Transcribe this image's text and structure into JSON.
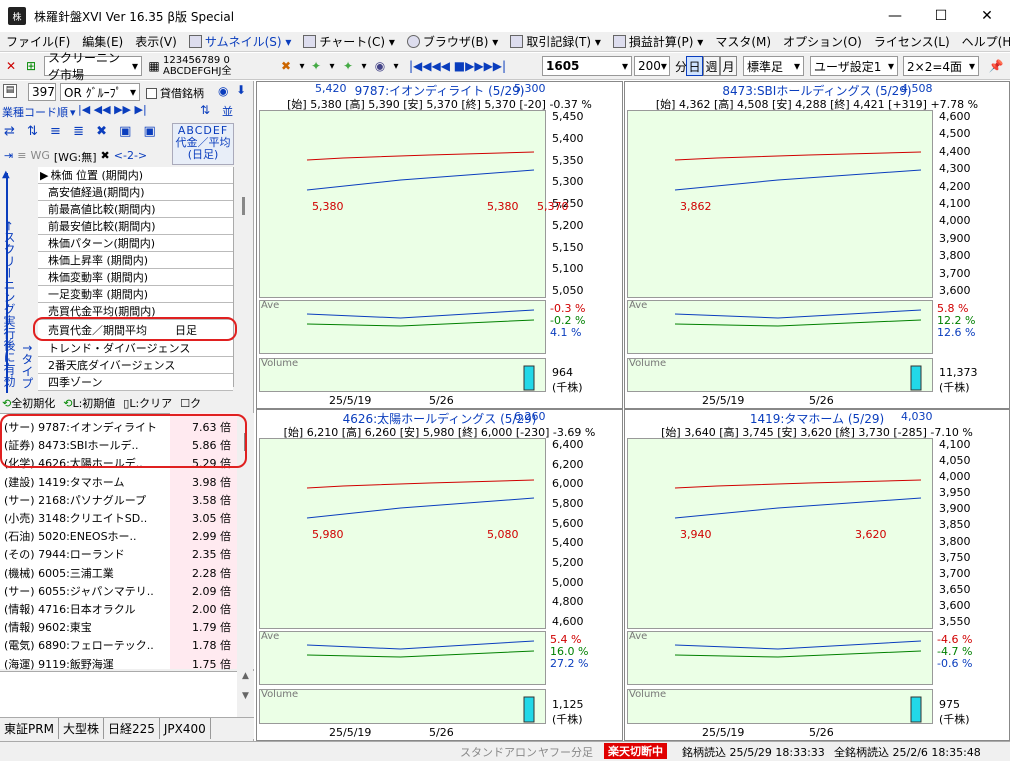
{
  "window": {
    "title": "株羅針盤XVI Ver 16.35 β版  Special",
    "app_icon": "株"
  },
  "menu": [
    "ファイル(F)",
    "編集(E)",
    "表示(V)",
    "サムネイル(S)",
    "チャート(C)",
    "ブラウザ(B)",
    "取引記録(T)",
    "損益計算(P)",
    "マスタ(M)",
    "オプション(O)",
    "ライセンス(L)",
    "ヘルプ(H)"
  ],
  "toolbar": {
    "market": "スクリーニング市場",
    "groups1": "123456789 0",
    "groups2": "ABCDEFGHJ全",
    "nav": "|◀◀◀◀ ■▶▶▶▶|",
    "code": "1605",
    "bars": "200",
    "period_unit": "分",
    "day_btn": "日",
    "week_btn": "週",
    "month_btn": "月",
    "standard_foot": "標準足",
    "user_setting": "ユーザ設定1",
    "layout": "2×2=4面",
    "pin": "ᚑ"
  },
  "left": {
    "count": "397",
    "group_sel": "OR ｸﾞﾙｰﾌﾟ",
    "credit_label": "貸借銘柄",
    "sort_label": "業種コード順",
    "abc": "ABCDEF",
    "wg": "WG",
    "wg_value": "[WG:無]",
    "range": "<-2->",
    "col_header": "代金／平均\n(日足)",
    "screen_label": "←スクリーニング実行後に有効",
    "type_label": "↑タイプ",
    "criteria": [
      "株価 位置 (期間内)",
      "高安値経過(期間内)",
      "前最高値比較(期間内)",
      "前最安値比較(期間内)",
      "株価パターン(期間内)",
      "株価上昇率 (期間内)",
      "株価変動率 (期間内)",
      "一足変動率 (期間内)",
      "売買代金平均(期間内)",
      "売買代金／期間平均",
      "トレンド・ダイバージェンス",
      "2番天底ダイバージェンス",
      "四季ゾーン"
    ],
    "selected_criterion": "売買代金／期間平均",
    "selected_foot": "日足",
    "btn_init_all": "全初期化",
    "btn_init_l": "L:初期値",
    "btn_clear_l": "L:クリア",
    "btn_k": "ク",
    "stocks": [
      {
        "name": "(サー) 9787:イオンディライト",
        "val": "7.63 倍"
      },
      {
        "name": "(証券) 8473:SBIホールデ..",
        "val": "5.86 倍"
      },
      {
        "name": "(化学) 4626:太陽ホールデ..",
        "val": "5.29 倍"
      },
      {
        "name": "(建設) 1419:タマホーム",
        "val": "3.98 倍"
      },
      {
        "name": "(サー) 2168:パソナグループ",
        "val": "3.58 倍"
      },
      {
        "name": "(小売) 3148:クリエイトSD..",
        "val": "3.05 倍"
      },
      {
        "name": "(石油) 5020:ENEOSホー..",
        "val": "2.99 倍"
      },
      {
        "name": "(その) 7944:ローランド",
        "val": "2.35 倍"
      },
      {
        "name": "(機械) 6005:三浦工業",
        "val": "2.28 倍"
      },
      {
        "name": "(サー) 6055:ジャパンマテリ..",
        "val": "2.09 倍"
      },
      {
        "name": "(情報) 4716:日本オラクル",
        "val": "2.00 倍"
      },
      {
        "name": "(情報) 9602:東宝",
        "val": "1.79 倍"
      },
      {
        "name": "(電気) 6890:フェローテック..",
        "val": "1.78 倍"
      },
      {
        "name": "(海運) 9119:飯野海運",
        "val": "1.75 倍"
      }
    ],
    "market_tabs": [
      "東証PRM",
      "大型株",
      "日経225",
      "JPX400"
    ]
  },
  "charts": [
    {
      "title": "9787:イオンディライト (5/29)",
      "info": "[始] 5,380 [高] 5,390 [安] 5,370 [終] 5,370 [-20] -0.37 %",
      "corner_left": "5,420",
      "corner_right": "5,300",
      "y_ticks": [
        "5,450",
        "5,400",
        "5,350",
        "5,300",
        "5,250",
        "5,200",
        "5,150",
        "5,100",
        "5,050"
      ],
      "labels": [
        {
          "t": "5,380",
          "c": "#d00000"
        },
        {
          "t": "5,380",
          "c": "#d00000"
        },
        {
          "t": "5,370",
          "c": "#d00000"
        }
      ],
      "ave_ticks": [
        "-0.3 %",
        "-0.2 %",
        "4.1 %"
      ],
      "ave_label": "Ave",
      "vol_label": "Volume",
      "vol_max": "964",
      "vol_unit": "(千株)",
      "dates": [
        "25/5/19",
        "5/26"
      ]
    },
    {
      "title": "8473:SBIホールディングス (5/29)",
      "info": "[始] 4,362 [高] 4,508 [安] 4,288 [終] 4,421 [+319] +7.78 %",
      "corner_left": "",
      "corner_right": "4,508",
      "y_ticks": [
        "4,600",
        "4,500",
        "4,400",
        "4,300",
        "4,200",
        "4,100",
        "4,000",
        "3,900",
        "3,800",
        "3,700",
        "3,600"
      ],
      "labels": [
        {
          "t": "3,862",
          "c": "#d00000"
        }
      ],
      "ave_ticks": [
        "5.8 %",
        "12.2 %",
        "12.6 %"
      ],
      "ave_label": "Ave",
      "vol_label": "Volume",
      "vol_max": "11,373",
      "vol_unit": "(千株)",
      "dates": [
        "25/5/19",
        "5/26"
      ]
    },
    {
      "title": "4626:太陽ホールディングス (5/29)",
      "info": "[始] 6,210 [高] 6,260 [安] 5,980 [終] 6,000 [-230] -3.69 %",
      "corner_left": "",
      "corner_right": "6,260",
      "y_ticks": [
        "6,400",
        "6,200",
        "6,000",
        "5,800",
        "5,600",
        "5,400",
        "5,200",
        "5,000",
        "4,800",
        "4,600"
      ],
      "labels": [
        {
          "t": "5,980",
          "c": "#d00000"
        },
        {
          "t": "5,080",
          "c": "#d00000"
        }
      ],
      "ave_ticks": [
        "5.4 %",
        "16.0 %",
        "27.2 %"
      ],
      "ave_label": "Ave",
      "vol_label": "Volume",
      "vol_max": "1,125",
      "vol_unit": "(千株)",
      "dates": [
        "25/5/19",
        "5/26"
      ]
    },
    {
      "title": "1419:タマホーム (5/29)",
      "info": "[始] 3,640 [高] 3,745 [安] 3,620 [終] 3,730 [-285] -7.10 %",
      "corner_left": "",
      "corner_right": "4,030",
      "y_ticks": [
        "4,100",
        "4,050",
        "4,000",
        "3,950",
        "3,900",
        "3,850",
        "3,800",
        "3,750",
        "3,700",
        "3,650",
        "3,600",
        "3,550"
      ],
      "labels": [
        {
          "t": "3,940",
          "c": "#d00000"
        },
        {
          "t": "3,620",
          "c": "#d00000"
        }
      ],
      "ave_ticks": [
        "-4.6 %",
        "-4.7 %",
        "-0.6 %"
      ],
      "ave_label": "Ave",
      "vol_label": "Volume",
      "vol_max": "975",
      "vol_unit": "(千株)",
      "dates": [
        "25/5/19",
        "5/26"
      ]
    }
  ],
  "status": {
    "standalone": "スタンドアロン",
    "yahoo": "ヤフー分足",
    "rakuten": "楽天切断中",
    "stock_read": "銘柄読込 25/5/29 18:33:33",
    "all_read": "全銘柄読込 25/2/6 18:35:48"
  },
  "colors": {
    "accent_blue": "#0a3dbd",
    "plot_bg": "#ebffe6",
    "rakuten_red": "#e00000",
    "highlight_red": "#e02020"
  }
}
